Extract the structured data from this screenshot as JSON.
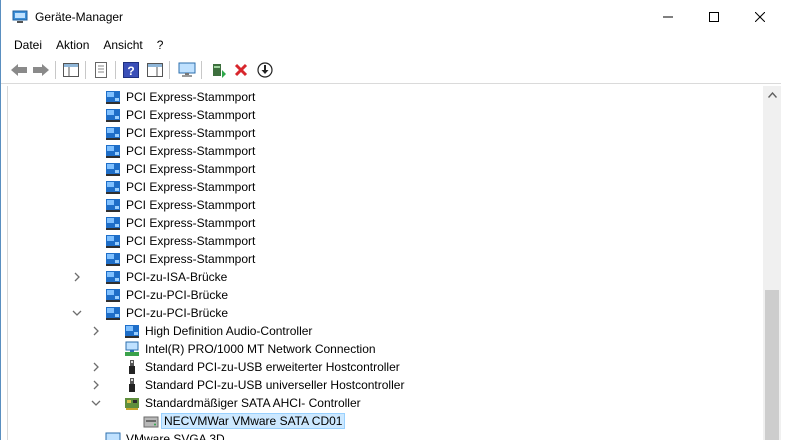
{
  "window": {
    "title": "Geräte-Manager"
  },
  "menu": {
    "items": [
      "Datei",
      "Aktion",
      "Ansicht",
      "?"
    ]
  },
  "toolbar": {
    "buttons": [
      "back-icon",
      "forward-icon",
      "show-hide-console-tree-icon",
      "properties-icon",
      "help-icon",
      "action-pane-icon",
      "monitor-icon",
      "update-driver-icon",
      "uninstall-icon",
      "download-icon"
    ]
  },
  "tree": {
    "rows": [
      {
        "label": "PCI Express-Stammport",
        "icon": "pci-icon",
        "indent": 1,
        "expander": ""
      },
      {
        "label": "PCI Express-Stammport",
        "icon": "pci-icon",
        "indent": 1,
        "expander": ""
      },
      {
        "label": "PCI Express-Stammport",
        "icon": "pci-icon",
        "indent": 1,
        "expander": ""
      },
      {
        "label": "PCI Express-Stammport",
        "icon": "pci-icon",
        "indent": 1,
        "expander": ""
      },
      {
        "label": "PCI Express-Stammport",
        "icon": "pci-icon",
        "indent": 1,
        "expander": ""
      },
      {
        "label": "PCI Express-Stammport",
        "icon": "pci-icon",
        "indent": 1,
        "expander": ""
      },
      {
        "label": "PCI Express-Stammport",
        "icon": "pci-icon",
        "indent": 1,
        "expander": ""
      },
      {
        "label": "PCI Express-Stammport",
        "icon": "pci-icon",
        "indent": 1,
        "expander": ""
      },
      {
        "label": "PCI Express-Stammport",
        "icon": "pci-icon",
        "indent": 1,
        "expander": ""
      },
      {
        "label": "PCI Express-Stammport",
        "icon": "pci-icon",
        "indent": 1,
        "expander": ""
      },
      {
        "label": "PCI-zu-ISA-Brücke",
        "icon": "pci-icon",
        "indent": 1,
        "expander": "collapsed"
      },
      {
        "label": "PCI-zu-PCI-Brücke",
        "icon": "pci-icon",
        "indent": 1,
        "expander": ""
      },
      {
        "label": "PCI-zu-PCI-Brücke",
        "icon": "pci-icon",
        "indent": 1,
        "expander": "expanded"
      },
      {
        "label": "High Definition Audio-Controller",
        "icon": "pci-icon",
        "indent": 2,
        "expander": "collapsed"
      },
      {
        "label": "Intel(R) PRO/1000 MT Network Connection",
        "icon": "network-icon",
        "indent": 2,
        "expander": ""
      },
      {
        "label": "Standard PCI-zu-USB erweiterter Hostcontroller",
        "icon": "usb-icon",
        "indent": 2,
        "expander": "collapsed"
      },
      {
        "label": "Standard PCI-zu-USB universeller Hostcontroller",
        "icon": "usb-icon",
        "indent": 2,
        "expander": "collapsed"
      },
      {
        "label": "Standardmäßiger SATA AHCI- Controller",
        "icon": "storage-controller-icon",
        "indent": 2,
        "expander": "expanded"
      },
      {
        "label": "NECVMWar VMware SATA CD01",
        "icon": "cd-drive-icon",
        "indent": 3,
        "expander": "",
        "selected": true
      },
      {
        "label": "VMware SVGA 3D",
        "icon": "display-icon",
        "indent": 1,
        "expander": ""
      }
    ]
  },
  "colors": {
    "accent": "#0078d7",
    "selection": "#cce8ff",
    "pci_blue": "#1e6ec8"
  }
}
